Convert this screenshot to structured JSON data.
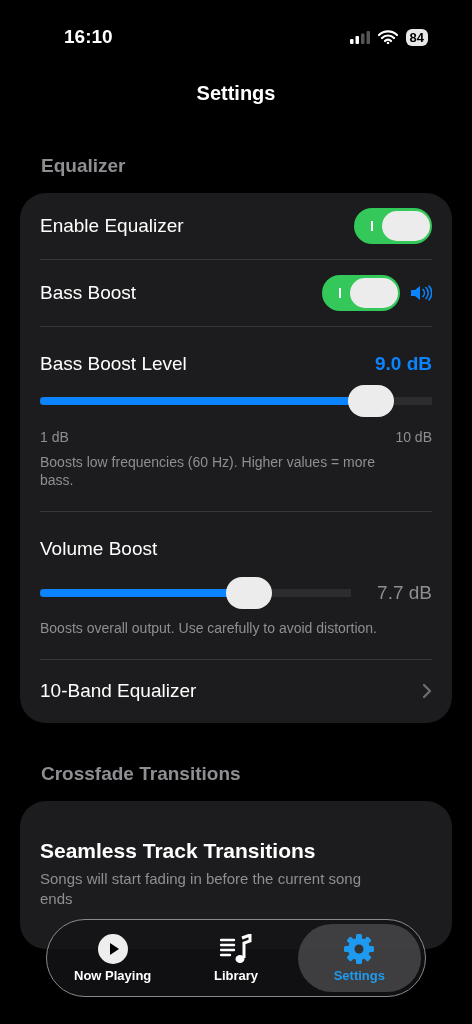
{
  "status_bar": {
    "time": "16:10",
    "battery": "84"
  },
  "title": "Settings",
  "sections": [
    {
      "header": "Equalizer",
      "rows": [
        {
          "kind": "toggle",
          "label": "Enable Equalizer",
          "on": true
        },
        {
          "kind": "toggle",
          "label": "Bass Boost",
          "on": true,
          "speaker_icon": true
        },
        {
          "kind": "slider_top",
          "label": "Bass Boost Level",
          "reading": "9.0 dB",
          "level": 0.89,
          "min_label": "1 dB",
          "max_label": "10 dB",
          "description": "Boosts low frequencies (60 Hz). Higher values = more bass."
        },
        {
          "kind": "slider_side",
          "label": "Volume Boost",
          "reading": "7.7 dB",
          "level": 0.7,
          "description": "Boosts overall output. Use carefully to avoid distortion."
        },
        {
          "kind": "link",
          "label": "10-Band Equalizer"
        }
      ]
    },
    {
      "header": "Crossfade Transitions",
      "rows": [
        {
          "kind": "heading",
          "label": "Seamless Track Transitions",
          "description": "Songs will start fading in before the current song ends"
        }
      ]
    }
  ],
  "tab_bar": [
    {
      "kind": "play",
      "label": "Now Playing",
      "selected": false
    },
    {
      "kind": "library",
      "label": "Library",
      "selected": false
    },
    {
      "kind": "gear",
      "label": "Settings",
      "selected": true
    }
  ]
}
